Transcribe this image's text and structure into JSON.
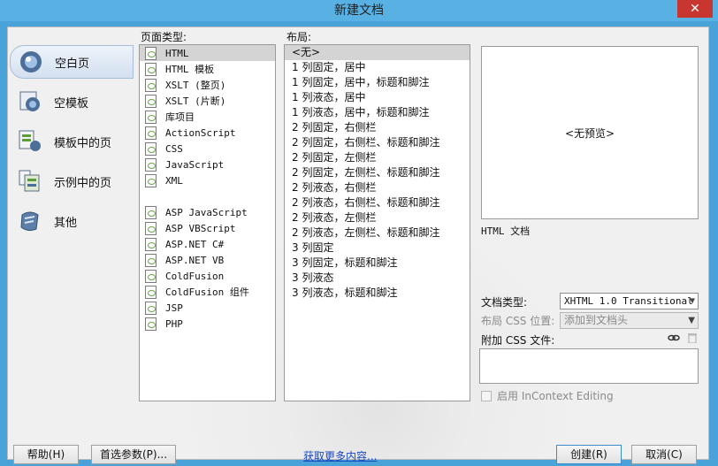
{
  "window": {
    "title": "新建文档",
    "close_glyph": "✕"
  },
  "sidebar": {
    "items": [
      {
        "label": "空白页",
        "icon": "blank-page-icon"
      },
      {
        "label": "空模板",
        "icon": "blank-template-icon"
      },
      {
        "label": "模板中的页",
        "icon": "page-from-template-icon"
      },
      {
        "label": "示例中的页",
        "icon": "page-from-sample-icon"
      },
      {
        "label": "其他",
        "icon": "other-icon"
      }
    ]
  },
  "page_types": {
    "label": "页面类型:",
    "items": [
      "HTML",
      "HTML 模板",
      "XSLT (整页)",
      "XSLT (片断)",
      "库项目",
      "ActionScript",
      "CSS",
      "JavaScript",
      "XML",
      "",
      "ASP JavaScript",
      "ASP VBScript",
      "ASP.NET C#",
      "ASP.NET VB",
      "ColdFusion",
      "ColdFusion 组件",
      "JSP",
      "PHP"
    ]
  },
  "layout": {
    "label": "布局:",
    "items": [
      "<无>",
      "1 列固定，居中",
      "1 列固定，居中，标题和脚注",
      "1 列液态，居中",
      "1 列液态，居中，标题和脚注",
      "2 列固定，右侧栏",
      "2 列固定，右侧栏、标题和脚注",
      "2 列固定，左侧栏",
      "2 列固定，左侧栏、标题和脚注",
      "2 列液态，右侧栏",
      "2 列液态，右侧栏、标题和脚注",
      "2 列液态，左侧栏",
      "2 列液态，左侧栏、标题和脚注",
      "3 列固定",
      "3 列固定，标题和脚注",
      "3 列液态",
      "3 列液态，标题和脚注"
    ]
  },
  "preview": {
    "text": "<无预览>",
    "description": "HTML 文档"
  },
  "form": {
    "doctype_label": "文档类型:",
    "doctype_value": "XHTML 1.0 Transitional",
    "layout_css_label": "布局 CSS 位置:",
    "layout_css_value": "添加到文档头",
    "attach_css_label": "附加 CSS 文件:",
    "incontext_label": "启用 InContext Editing"
  },
  "buttons": {
    "help": "帮助(H)",
    "preferences": "首选参数(P)...",
    "more_content": "获取更多内容...",
    "create": "创建(R)",
    "cancel": "取消(C)"
  },
  "colors": {
    "title_bar": "#58b0e3",
    "close": "#c7372f",
    "link": "#1a48c2"
  }
}
